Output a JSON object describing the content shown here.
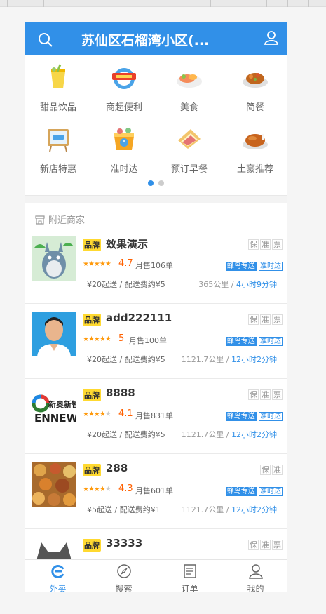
{
  "header": {
    "title": "苏仙区石榴湾小区(..."
  },
  "categories": [
    {
      "label": "甜品饮品",
      "icon": "drink-icon"
    },
    {
      "label": "商超便利",
      "icon": "supermarket-icon"
    },
    {
      "label": "美食",
      "icon": "food-plate-icon"
    },
    {
      "label": "简餐",
      "icon": "simple-meal-icon"
    },
    {
      "label": "新店特惠",
      "icon": "new-shop-icon"
    },
    {
      "label": "准时达",
      "icon": "ontime-icon"
    },
    {
      "label": "预订早餐",
      "icon": "breakfast-icon"
    },
    {
      "label": "土豪推荐",
      "icon": "chicken-icon"
    }
  ],
  "carousel": {
    "pages": 2,
    "current": 1
  },
  "section": {
    "title": "附近商家"
  },
  "shops": [
    {
      "brand": "品牌",
      "name": "效果演示",
      "guarantees": [
        "保",
        "准",
        "票"
      ],
      "rating": "4.7",
      "rating_value": 4.7,
      "sales": "月售106单",
      "delivery": [
        "蜂鸟专送",
        "准时达"
      ],
      "fee": "¥20起送 / 配送费约¥5",
      "distance": "365公里",
      "time": "4小时9分钟",
      "logo": "totoro-logo"
    },
    {
      "brand": "品牌",
      "name": "add222111",
      "guarantees": [
        "保",
        "准",
        "票"
      ],
      "rating": "5",
      "rating_value": 5,
      "sales": "月售100单",
      "delivery": [
        "蜂鸟专送",
        "准时达"
      ],
      "fee": "¥20起送 / 配送费约¥5",
      "distance": "1121.7公里",
      "time": "12小时2分钟",
      "logo": "person-photo-logo"
    },
    {
      "brand": "品牌",
      "name": "8888",
      "guarantees": [
        "保",
        "准",
        "票"
      ],
      "rating": "4.1",
      "rating_value": 4.1,
      "sales": "月售831单",
      "delivery": [
        "蜂鸟专送",
        "准时达"
      ],
      "fee": "¥20起送 / 配送费约¥5",
      "distance": "1121.7公里",
      "time": "12小时2分钟",
      "logo": "ennew-logo"
    },
    {
      "brand": "品牌",
      "name": "288",
      "guarantees": [
        "保",
        "准"
      ],
      "rating": "4.3",
      "rating_value": 4.3,
      "sales": "月售601单",
      "delivery": [
        "蜂鸟专送",
        "准时达"
      ],
      "fee": "¥5起送 / 配送费约¥1",
      "distance": "1121.7公里",
      "time": "12小时2分钟",
      "logo": "food-dishes-logo"
    },
    {
      "brand": "品牌",
      "name": "33333",
      "guarantees": [
        "保",
        "准",
        "票"
      ],
      "logo": "cat-logo"
    }
  ],
  "ennew_logo": {
    "line1": "新奥新智",
    "line2": "ENNEW"
  },
  "tabs": [
    {
      "label": "外卖",
      "icon": "takeout-icon",
      "active": true
    },
    {
      "label": "搜索",
      "icon": "compass-icon",
      "active": false
    },
    {
      "label": "订单",
      "icon": "order-icon",
      "active": false
    },
    {
      "label": "我的",
      "icon": "profile-icon",
      "active": false
    }
  ],
  "colors": {
    "primary": "#3190e8",
    "brand_tag": "#ffd930",
    "star": "#ff9a0d",
    "rating": "#ff6000"
  }
}
